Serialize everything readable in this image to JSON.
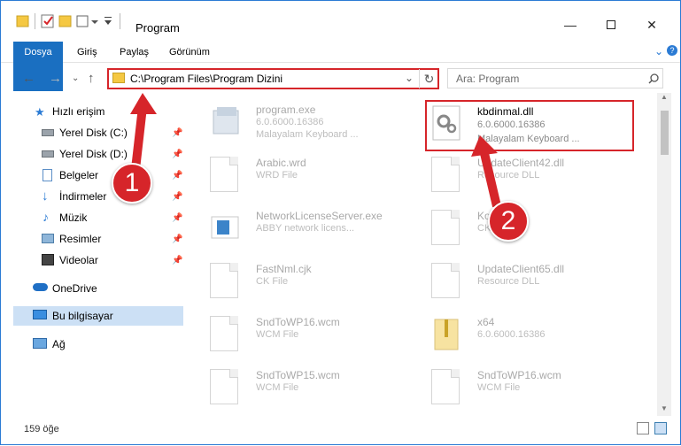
{
  "window": {
    "title": "Program",
    "minimize_icon": "minimize-icon",
    "maximize_icon": "maximize-icon",
    "close_icon": "close-icon"
  },
  "ribbon": {
    "tabs": [
      "Dosya",
      "Giriş",
      "Paylaş",
      "Görünüm"
    ]
  },
  "address": {
    "path": "C:\\Program Files\\Program Dizini",
    "search_placeholder": "Ara: Program"
  },
  "sidebar": {
    "items": [
      {
        "label": "Hızlı erişim",
        "icon": "star-icon",
        "pinned": false
      },
      {
        "label": "Yerel Disk (C:)",
        "icon": "drive-icon",
        "pinned": true
      },
      {
        "label": "Yerel Disk (D:)",
        "icon": "drive-icon",
        "pinned": true
      },
      {
        "label": "Belgeler",
        "icon": "document-icon",
        "pinned": true
      },
      {
        "label": "İndirmeler",
        "icon": "download-icon",
        "pinned": true
      },
      {
        "label": "Müzik",
        "icon": "music-icon",
        "pinned": true
      },
      {
        "label": "Resimler",
        "icon": "picture-icon",
        "pinned": true
      },
      {
        "label": "Videolar",
        "icon": "video-icon",
        "pinned": true
      },
      {
        "label": "OneDrive",
        "icon": "cloud-icon",
        "pinned": false
      },
      {
        "label": "Bu bilgisayar",
        "icon": "computer-icon",
        "pinned": false,
        "selected": true
      },
      {
        "label": "Ağ",
        "icon": "network-icon",
        "pinned": false
      }
    ]
  },
  "files": [
    {
      "name": "program.exe",
      "line1": "6.0.6000.16386",
      "line2": "Malayalam Keyboard ...",
      "faded": true
    },
    {
      "name": "kbdinmal.dll",
      "line1": "6.0.6000.16386",
      "line2": "Malayalam Keyboard ...",
      "faded": false,
      "highlighted": true
    },
    {
      "name": "Arabic.wrd",
      "line1": "WRD File",
      "line2": "",
      "faded": true
    },
    {
      "name": "UpdateClient42.dll",
      "line1": "Resource DLL",
      "line2": "",
      "faded": true
    },
    {
      "name": "NetworkLicenseServer.exe",
      "line1": "ABBY network licens...",
      "line2": "",
      "faded": true
    },
    {
      "name": "Kono",
      "line1": "CK File",
      "line2": "",
      "faded": true
    },
    {
      "name": "FastNml.cjk",
      "line1": "CK File",
      "line2": "",
      "faded": true
    },
    {
      "name": "UpdateClient65.dll",
      "line1": "Resource DLL",
      "line2": "",
      "faded": true
    },
    {
      "name": "SndToWP16.wcm",
      "line1": "WCM File",
      "line2": "",
      "faded": true
    },
    {
      "name": "x64",
      "line1": "6.0.6000.16386",
      "line2": "",
      "faded": true
    },
    {
      "name": "SndToWP15.wcm",
      "line1": "WCM File",
      "line2": "",
      "faded": true
    },
    {
      "name": "SndToWP16.wcm",
      "line1": "WCM File",
      "line2": "",
      "faded": true
    }
  ],
  "status": {
    "count": "159 öğe"
  },
  "annotations": {
    "badge1": "1",
    "badge2": "2",
    "color": "#d6252a"
  }
}
